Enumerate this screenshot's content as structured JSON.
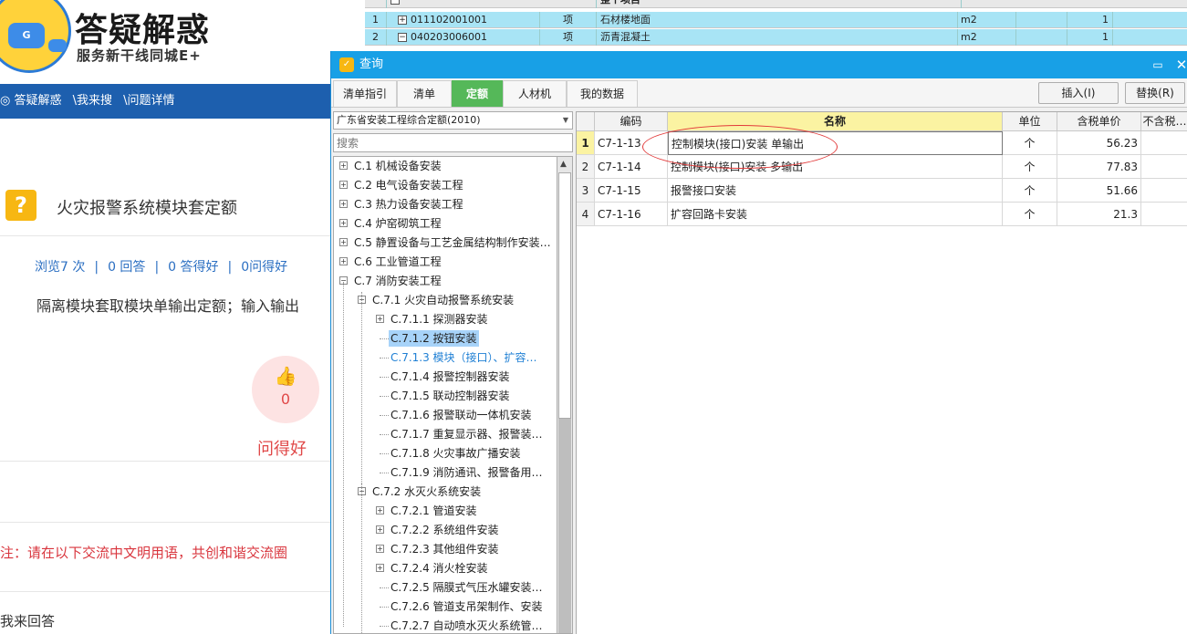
{
  "web": {
    "brand_title": "答疑解惑",
    "brand_subtitle": "服务新干线同城E+",
    "mascot_letter": "G",
    "breadcrumb": [
      "◎ 答疑解惑",
      "\\我来搜",
      "\\问题详情"
    ],
    "question_icon": "?",
    "question_title": "火灾报警系统模块套定额",
    "stats": {
      "views": "浏览7 次",
      "answers": "0 回答",
      "good_answers": "0 答得好",
      "good_questions": "0问得好",
      "separator": "|"
    },
    "question_body": "隔离模块套取模块单输出定额；输入输出",
    "like_count": "0",
    "like_label": "问得好",
    "notice": "注：请在以下交流中文明用语，共创和谐交流圈",
    "answer_label": "我来回答",
    "colors": {
      "header_blue": "#1d5fae",
      "accent_red": "#e04848",
      "link_blue": "#2b6fc2"
    }
  },
  "bg_grid": {
    "header_label": "整个项目",
    "rows": [
      {
        "no": "1",
        "toggle": "+",
        "code": "011102001001",
        "type": "项",
        "name": "石材楼地面",
        "unit": "m2",
        "qty": "1"
      },
      {
        "no": "2",
        "toggle": "−",
        "code": "040203006001",
        "type": "项",
        "name": "沥青混凝土",
        "unit": "m2",
        "qty": "1"
      }
    ]
  },
  "dialog": {
    "title": "查询",
    "tabs": [
      {
        "label": "清单指引",
        "active": false
      },
      {
        "label": "清单",
        "active": false
      },
      {
        "label": "定额",
        "active": true
      },
      {
        "label": "人材机",
        "active": false
      },
      {
        "label": "我的数据",
        "active": false
      }
    ],
    "insert_button": "插入(I)",
    "replace_button": "替换(R)",
    "library_select": "广东省安装工程综合定额(2010)",
    "search_placeholder": "搜索",
    "tree": [
      {
        "label": "C.1 机械设备安装",
        "level": 0,
        "toggle": "+"
      },
      {
        "label": "C.2 电气设备安装工程",
        "level": 0,
        "toggle": "+"
      },
      {
        "label": "C.3 热力设备安装工程",
        "level": 0,
        "toggle": "+"
      },
      {
        "label": "C.4 炉窑砌筑工程",
        "level": 0,
        "toggle": "+"
      },
      {
        "label": "C.5 静置设备与工艺金属结构制作安装…",
        "level": 0,
        "toggle": "+"
      },
      {
        "label": "C.6 工业管道工程",
        "level": 0,
        "toggle": "+"
      },
      {
        "label": "C.7 消防安装工程",
        "level": 0,
        "toggle": "−"
      },
      {
        "label": "C.7.1 火灾自动报警系统安装",
        "level": 1,
        "toggle": "−"
      },
      {
        "label": "C.7.1.1 探测器安装",
        "level": 2,
        "toggle": "+"
      },
      {
        "label": "C.7.1.2 按钮安装",
        "level": 2,
        "toggle": "",
        "selected": true
      },
      {
        "label": "C.7.1.3 模块（接口）、扩容…",
        "level": 2,
        "toggle": "",
        "current": true
      },
      {
        "label": "C.7.1.4 报警控制器安装",
        "level": 2,
        "toggle": ""
      },
      {
        "label": "C.7.1.5 联动控制器安装",
        "level": 2,
        "toggle": ""
      },
      {
        "label": "C.7.1.6 报警联动一体机安装",
        "level": 2,
        "toggle": ""
      },
      {
        "label": "C.7.1.7 重复显示器、报警装…",
        "level": 2,
        "toggle": ""
      },
      {
        "label": "C.7.1.8 火灾事故广播安装",
        "level": 2,
        "toggle": ""
      },
      {
        "label": "C.7.1.9 消防通讯、报警备用…",
        "level": 2,
        "toggle": ""
      },
      {
        "label": "C.7.2 水灭火系统安装",
        "level": 1,
        "toggle": "−"
      },
      {
        "label": "C.7.2.1 管道安装",
        "level": 2,
        "toggle": "+"
      },
      {
        "label": "C.7.2.2 系统组件安装",
        "level": 2,
        "toggle": "+"
      },
      {
        "label": "C.7.2.3 其他组件安装",
        "level": 2,
        "toggle": "+"
      },
      {
        "label": "C.7.2.4 消火栓安装",
        "level": 2,
        "toggle": "+"
      },
      {
        "label": "C.7.2.5 隔膜式气压水罐安装…",
        "level": 2,
        "toggle": ""
      },
      {
        "label": "C.7.2.6 管道支吊架制作、安装",
        "level": 2,
        "toggle": ""
      },
      {
        "label": "C.7.2.7 自动喷水灭火系统管…",
        "level": 2,
        "toggle": ""
      }
    ],
    "grid": {
      "headers": [
        "编码",
        "名称",
        "单位",
        "含税单价",
        "不含税…"
      ],
      "rows": [
        {
          "no": "1",
          "code": "C7-1-13",
          "name": "控制模块(接口)安装 单输出",
          "unit": "个",
          "price": "56.23",
          "current": true
        },
        {
          "no": "2",
          "code": "C7-1-14",
          "name": "控制模块(接口)安装 多输出",
          "unit": "个",
          "price": "77.83"
        },
        {
          "no": "3",
          "code": "C7-1-15",
          "name": "报警接口安装",
          "unit": "个",
          "price": "51.66"
        },
        {
          "no": "4",
          "code": "C7-1-16",
          "name": "扩容回路卡安装",
          "unit": "个",
          "price": "21.3"
        }
      ]
    },
    "colors": {
      "titlebar": "#18a0e6",
      "active_tab": "#55b859",
      "selected_row": "#a7d3f9",
      "header_highlight": "#fbf3a2",
      "annotation": "#e23a3a"
    }
  }
}
